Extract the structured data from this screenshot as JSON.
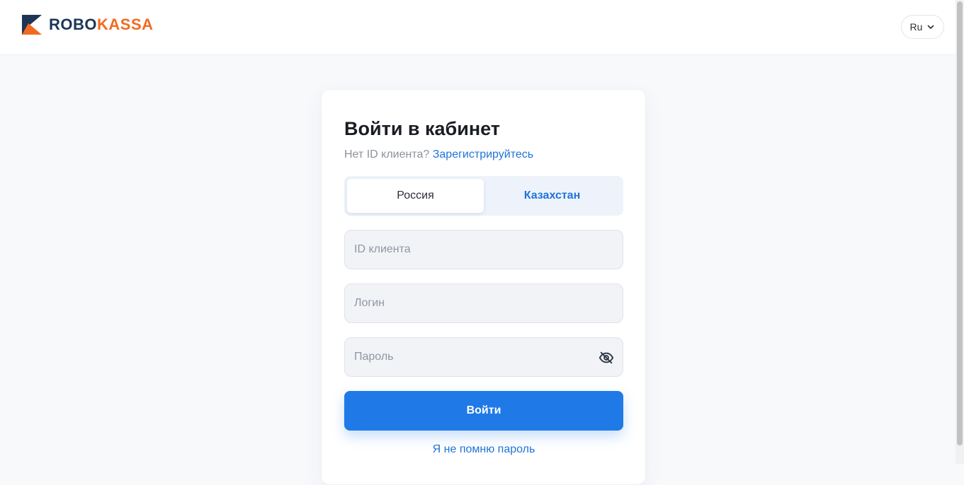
{
  "header": {
    "logo": {
      "part1": "ROBO",
      "part2": "KASSA",
      "mark_color_dark": "#1d3557",
      "mark_color_accent": "#f26a21"
    },
    "language": {
      "selected": "Ru",
      "icon": "chevron-down-icon"
    }
  },
  "login": {
    "title": "Войти в кабинет",
    "no_id_text": "Нет ID клиента?",
    "register_link": "Зарегистрируйтесь",
    "tabs": [
      {
        "label": "Россия",
        "active": true
      },
      {
        "label": "Казахстан",
        "active": false
      }
    ],
    "fields": {
      "client_id": {
        "placeholder": "ID клиента",
        "value": ""
      },
      "login": {
        "placeholder": "Логин",
        "value": ""
      },
      "password": {
        "placeholder": "Пароль",
        "value": "",
        "toggle_icon": "eye-off-icon"
      }
    },
    "submit_label": "Войти",
    "forgot_label": "Я не помню пароль"
  },
  "colors": {
    "accent": "#1f7ae8",
    "link": "#1f74d8",
    "brand_orange": "#f26a21",
    "brand_dark": "#1d3557"
  }
}
